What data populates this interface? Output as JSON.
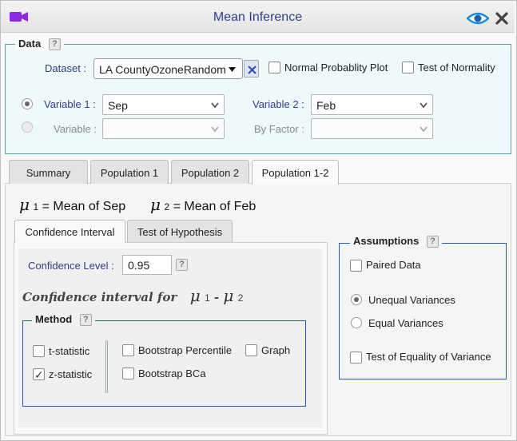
{
  "window": {
    "title": "Mean Inference",
    "icons": [
      "video-camera-icon",
      "eye-icon",
      "close-icon"
    ],
    "accent": "#2e3d8c"
  },
  "data_section": {
    "legend": "Data",
    "help": "?",
    "dataset_label": "Dataset :",
    "dataset_value": "LA CountyOzoneRandom",
    "normal_plot_label": "Normal Probablity Plot",
    "normality_label": "Test of Normality",
    "variable1_label": "Variable 1 :",
    "variable1_value": "Sep",
    "variable2_label": "Variable 2 :",
    "variable2_value": "Feb",
    "variable_label": "Variable :",
    "byfactor_label": "By Factor :"
  },
  "tabs": [
    "Summary",
    "Population 1",
    "Population 2",
    "Population 1-2"
  ],
  "active_tab": "Population 1-2",
  "defs": {
    "mu": "μ",
    "one": "1",
    "two": "2",
    "mean1": "= Mean of Sep",
    "mean2": "= Mean of Feb"
  },
  "inner_tabs": [
    "Confidence Interval",
    "Test of Hypothesis"
  ],
  "confidence": {
    "level_label": "Confidence Level :",
    "level_value": "0.95",
    "help": "?",
    "title_prefix": "Confidence interval for",
    "minus": "-"
  },
  "method": {
    "legend": "Method",
    "help": "?",
    "t_stat": "t-statistic",
    "z_stat": "z-statistic",
    "z_checked": true,
    "boot_pct": "Bootstrap Percentile",
    "boot_bca": "Bootstrap BCa",
    "graph": "Graph"
  },
  "assumptions": {
    "legend": "Assumptions",
    "help": "?",
    "paired": "Paired Data",
    "unequal": "Unequal Variances",
    "equal": "Equal Variances",
    "equality_test": "Test of Equality of Variance",
    "selected": "Unequal Variances"
  }
}
